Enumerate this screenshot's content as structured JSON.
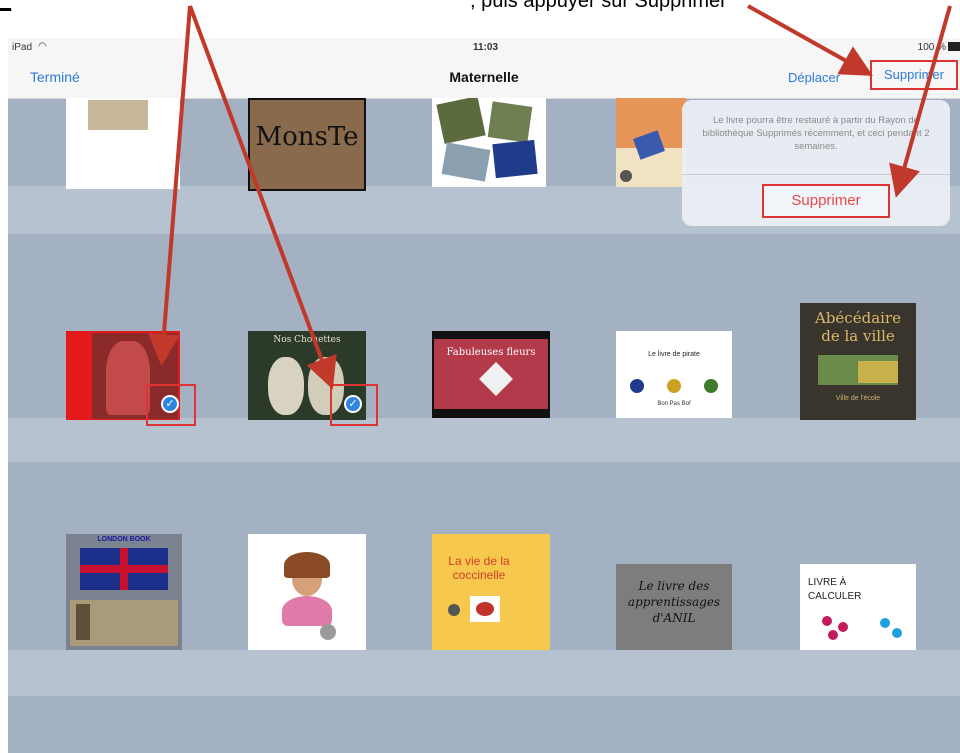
{
  "caption": {
    "fragment_left": "_",
    "fragment_right": ", puis appuyer sur Supprimer"
  },
  "status_bar": {
    "carrier": "iPad",
    "time": "11:03",
    "battery": "100 %"
  },
  "nav": {
    "done": "Terminé",
    "title": "Maternelle",
    "move": "Déplacer",
    "delete": "Supprimer"
  },
  "popover": {
    "message": "Le livre pourra être restauré à partir du Rayon de bibliothèque Supprimés récemment, et ceci pendant 2 semaines.",
    "button": "Supprimer"
  },
  "books": {
    "r1": {
      "b1": {
        "label": ""
      },
      "b2": {
        "label": "MonsTe"
      },
      "b3": {
        "label": ""
      },
      "b4": {
        "label": ""
      }
    },
    "r2": {
      "b1": {
        "label": "",
        "selected": true
      },
      "b2": {
        "label": "Nos Chouettes",
        "selected": true
      },
      "b3": {
        "label": "Fabuleuses fleurs"
      },
      "b4": {
        "label": "Le livre de pirate",
        "sub": "Bon   Pas   Bof"
      },
      "b5": {
        "label": "Abécédaire de la ville",
        "sub": "Ville de l'école"
      }
    },
    "r3": {
      "b1": {
        "label": "LONDON BOOK"
      },
      "b2": {
        "label": ""
      },
      "b3": {
        "label": "La vie de la coccinelle"
      },
      "b4": {
        "label": "Le livre des apprentissages d'ANIL"
      },
      "b5": {
        "label": "LIVRE À CALCULER"
      }
    }
  },
  "colors": {
    "accent": "#2d7bd6",
    "annotation": "#c0392b",
    "destructive": "#e54b4b",
    "shelf_bg": "#a3b1c2"
  }
}
